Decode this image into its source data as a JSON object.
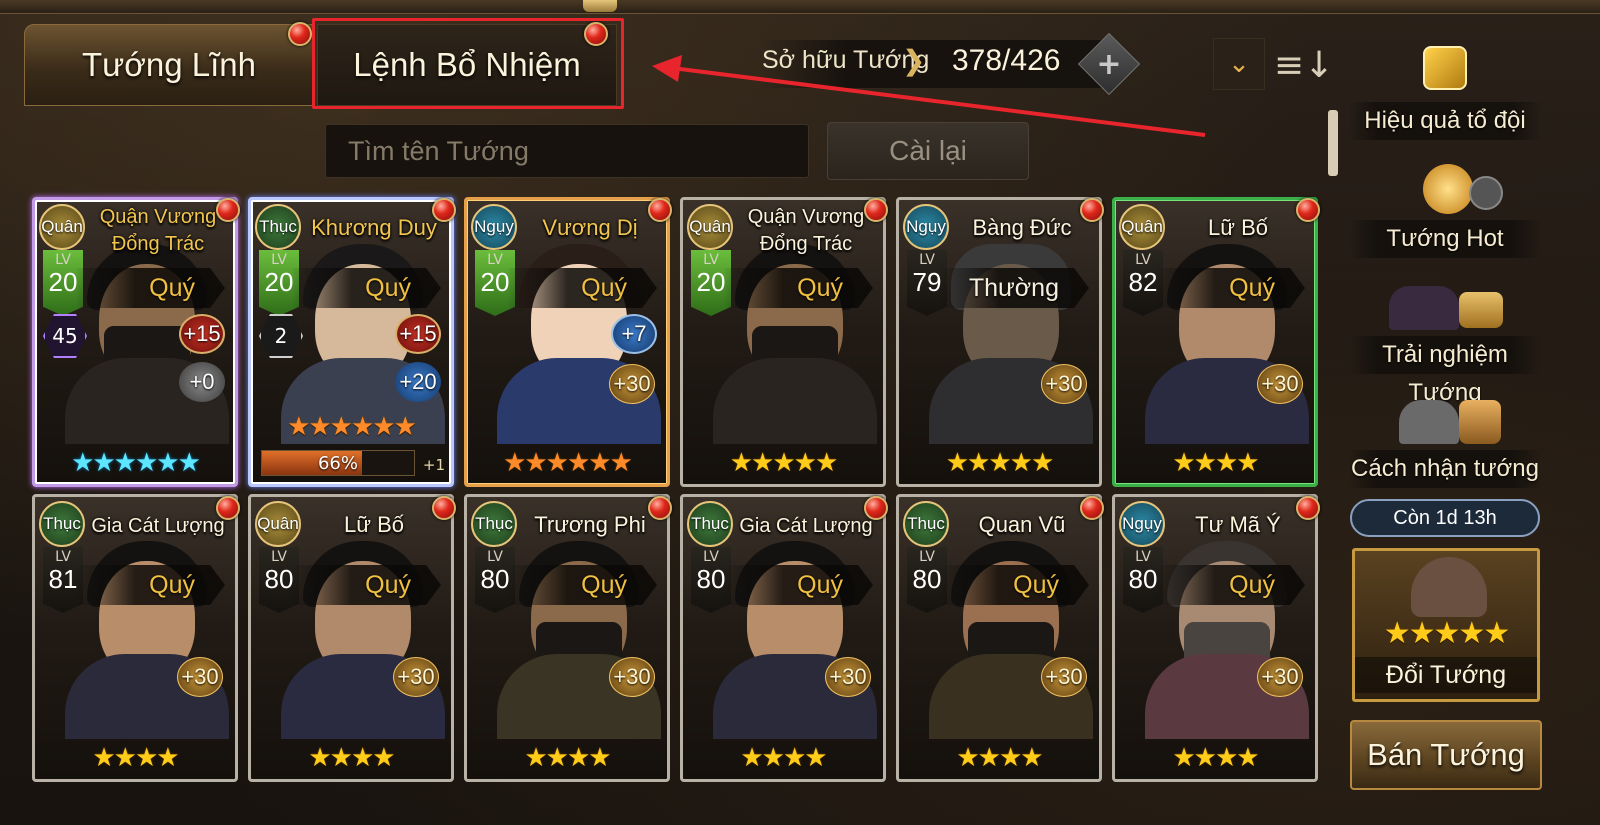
{
  "tabs": [
    {
      "label": "Tướng Lĩnh"
    },
    {
      "label": "Lệnh Bổ Nhiệm"
    }
  ],
  "owned": {
    "label": "Sở hữu Tướng",
    "arrow": "❯",
    "count": "378/426",
    "plus": "+"
  },
  "toolbar": {
    "dropdown": "⌄",
    "sort": "≡↓"
  },
  "search": {
    "placeholder": "Tìm tên Tướng",
    "reset_label": "Cài lại"
  },
  "cards_row1": [
    {
      "faction": "Quân",
      "name": "Quận Vương Đổng Trác",
      "level": "20",
      "lv_label": "LV",
      "rarity": "Quý",
      "hex": "45",
      "badge_top": "+15",
      "badge_mid": "+0",
      "progress_text": "",
      "plus_one": ""
    },
    {
      "faction": "Thục",
      "name": "Khương Duy",
      "level": "20",
      "lv_label": "LV",
      "rarity": "Quý",
      "hex": "2",
      "badge_top": "+15",
      "badge_mid": "+20",
      "progress_text": "66%",
      "plus_one": "+1"
    },
    {
      "faction": "Ngụy",
      "name": "Vương Dị",
      "level": "20",
      "lv_label": "LV",
      "rarity": "Quý",
      "badge_top": "+7",
      "badge_gold": "+30"
    },
    {
      "faction": "Quân",
      "name": "Quận Vương Đổng Trác",
      "level": "20",
      "lv_label": "LV",
      "rarity": "Quý"
    },
    {
      "faction": "Ngụy",
      "name": "Bàng Đức",
      "level": "79",
      "lv_label": "LV",
      "rarity": "Thường",
      "badge_gold": "+30"
    },
    {
      "faction": "Quân",
      "name": "Lữ Bố",
      "level": "82",
      "lv_label": "LV",
      "rarity": "Quý",
      "badge_gold": "+30"
    }
  ],
  "cards_row2": [
    {
      "faction": "Thục",
      "name": "Gia Cát Lượng",
      "level": "81",
      "lv_label": "LV",
      "rarity": "Quý",
      "badge_gold": "+30"
    },
    {
      "faction": "Quân",
      "name": "Lữ Bố",
      "level": "80",
      "lv_label": "LV",
      "rarity": "Quý",
      "badge_gold": "+30"
    },
    {
      "faction": "Thục",
      "name": "Trương Phi",
      "level": "80",
      "lv_label": "LV",
      "rarity": "Quý",
      "badge_gold": "+30"
    },
    {
      "faction": "Thục",
      "name": "Gia Cát Lượng",
      "level": "80",
      "lv_label": "LV",
      "rarity": "Quý",
      "badge_gold": "+30"
    },
    {
      "faction": "Thục",
      "name": "Quan Vũ",
      "level": "80",
      "lv_label": "LV",
      "rarity": "Quý",
      "badge_gold": "+30"
    },
    {
      "faction": "Ngụy",
      "name": "Tư Mã Ý",
      "level": "80",
      "lv_label": "LV",
      "rarity": "Quý",
      "badge_gold": "+30"
    }
  ],
  "stars": {
    "c1": "★★★★★★",
    "c2": "★★★★★★",
    "c3": "★★★★★★",
    "c4": "★★★★★",
    "c5": "★★★★★",
    "c6": "★★★★",
    "r2": "★★★★"
  },
  "sidebar": {
    "items": [
      {
        "label": "Hiệu quả tổ đội"
      },
      {
        "label": "Tướng Hot"
      },
      {
        "label": "Trải nghiệm Tướng"
      },
      {
        "label": "Cách nhận tướng"
      }
    ],
    "timer": "Còn 1d 13h",
    "exchange_label": "Đổi Tướng",
    "exchange_stars": "★★★★★",
    "sell_label": "Bán Tướng"
  },
  "colors": {
    "annotation": "#e8242c",
    "gold_text": "#f0c040",
    "accent_border": "#c89a40"
  },
  "progress": {
    "percent": 66
  }
}
